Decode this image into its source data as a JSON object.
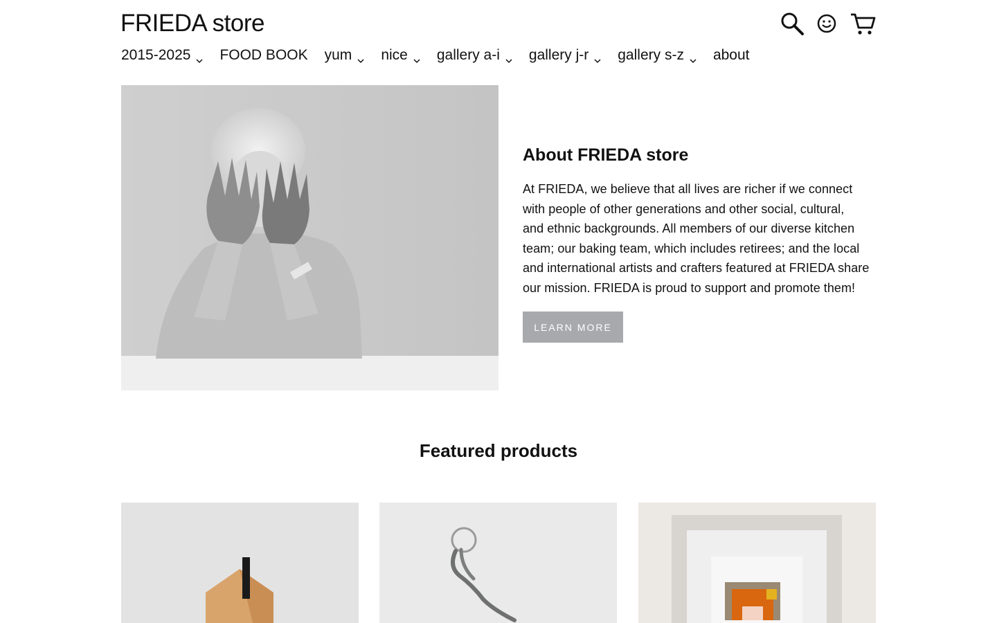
{
  "header": {
    "logo": "FRIEDA store",
    "icons": [
      "search-icon",
      "account-icon",
      "cart-icon"
    ]
  },
  "nav": {
    "items": [
      {
        "label": "2015-2025",
        "has_dropdown": true
      },
      {
        "label": "FOOD BOOK",
        "has_dropdown": false
      },
      {
        "label": "yum",
        "has_dropdown": true
      },
      {
        "label": "nice",
        "has_dropdown": true
      },
      {
        "label": "gallery a-i",
        "has_dropdown": true
      },
      {
        "label": "gallery j-r",
        "has_dropdown": true
      },
      {
        "label": "gallery s-z",
        "has_dropdown": true
      },
      {
        "label": "about",
        "has_dropdown": false
      }
    ]
  },
  "about": {
    "title": "About FRIEDA store",
    "body_lines": [
      "At FRIEDA, we believe that all lives are richer if we connect",
      "with people of other generations and other social, cultural,",
      "and ethnic backgrounds. All members of our diverse kitchen",
      "team; our baking team, which includes retirees; and the local",
      "and international artists and crafters featured at FRIEDA share",
      "our mission. FRIEDA is proud to support and promote them!"
    ],
    "button_label": "LEARN MORE"
  },
  "featured": {
    "title": "Featured products"
  },
  "colors": {
    "text": "#111111",
    "button_bg": "#a8a9ad",
    "button_text": "#ffffff",
    "background": "#ffffff"
  }
}
